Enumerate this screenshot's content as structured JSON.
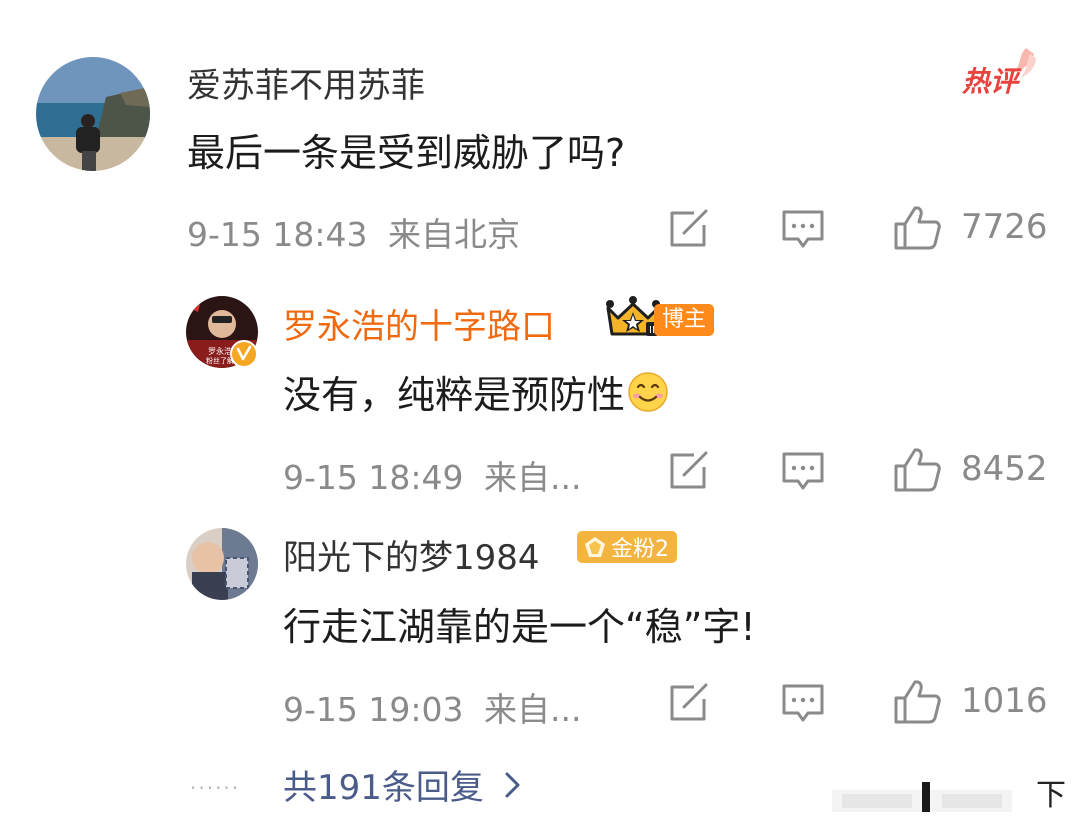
{
  "main_comment": {
    "username": "爱苏菲不用苏菲",
    "hot_badge": "热评",
    "content": "最后一条是受到威胁了吗?",
    "time": "9-15 18:43",
    "location": "来自北京",
    "likes": "7726"
  },
  "replies": [
    {
      "username": "罗永浩的十字路口",
      "role_badge": "博主",
      "content": "没有，纯粹是预防性",
      "emoji": "smile-emoji",
      "time": "9-15 18:49",
      "location": "来自...",
      "likes": "8452",
      "avatar_text_1": "罗永浩",
      "avatar_text_2": "粉丝了解"
    },
    {
      "username": "阳光下的梦1984",
      "fan_badge": "金粉2",
      "content": "行走江湖靠的是一个“稳”字!",
      "time": "9-15 19:03",
      "location": "来自...",
      "likes": "1016"
    }
  ],
  "footer": {
    "dots": "......",
    "more_replies": "共191条回复",
    "chevron": "chevron-right-icon",
    "corner_text": "下"
  },
  "colors": {
    "accent_orange": "#f06a10",
    "hot_red": "#e8433f",
    "gold_badge": "#f3b53f",
    "reply_link": "#4b5b8a",
    "meta_gray": "#8a8a8a"
  }
}
